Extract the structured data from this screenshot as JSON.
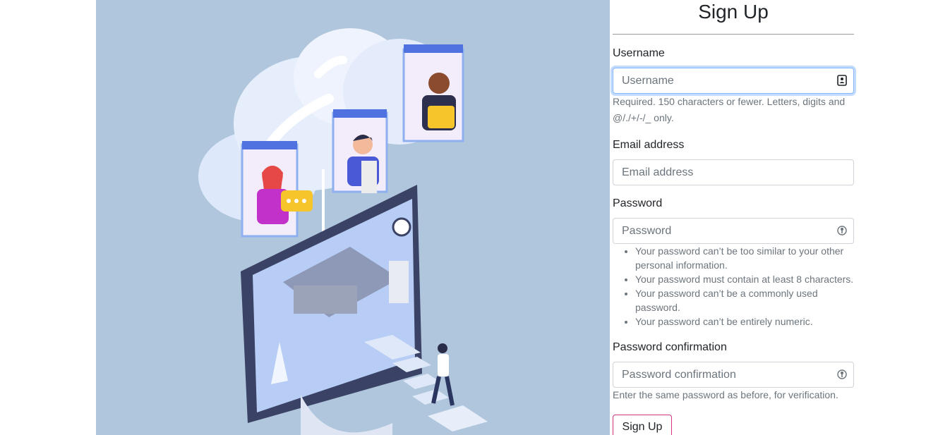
{
  "form": {
    "title": "Sign Up",
    "username": {
      "label": "Username",
      "placeholder": "Username",
      "help": "Required. 150 characters or fewer. Letters, digits and @/./+/-/_ only."
    },
    "email": {
      "label": "Email address",
      "placeholder": "Email address"
    },
    "password": {
      "label": "Password",
      "placeholder": "Password",
      "rules": [
        "Your password can’t be too similar to your other personal information.",
        "Your password must contain at least 8 characters.",
        "Your password can’t be a commonly used password.",
        "Your password can’t be entirely numeric."
      ]
    },
    "password_confirmation": {
      "label": "Password confirmation",
      "placeholder": "Password confirmation",
      "help": "Enter the same password as before, for verification."
    },
    "submit_label": "Sign Up"
  },
  "colors": {
    "illustration_bg": "#b0c6dc",
    "submit_border": "#d63384",
    "focus_border": "#86b7fe"
  },
  "icons": {
    "username_field": "contact-card-icon",
    "password_field": "password-key-icon",
    "password_confirmation_field": "password-key-icon"
  }
}
